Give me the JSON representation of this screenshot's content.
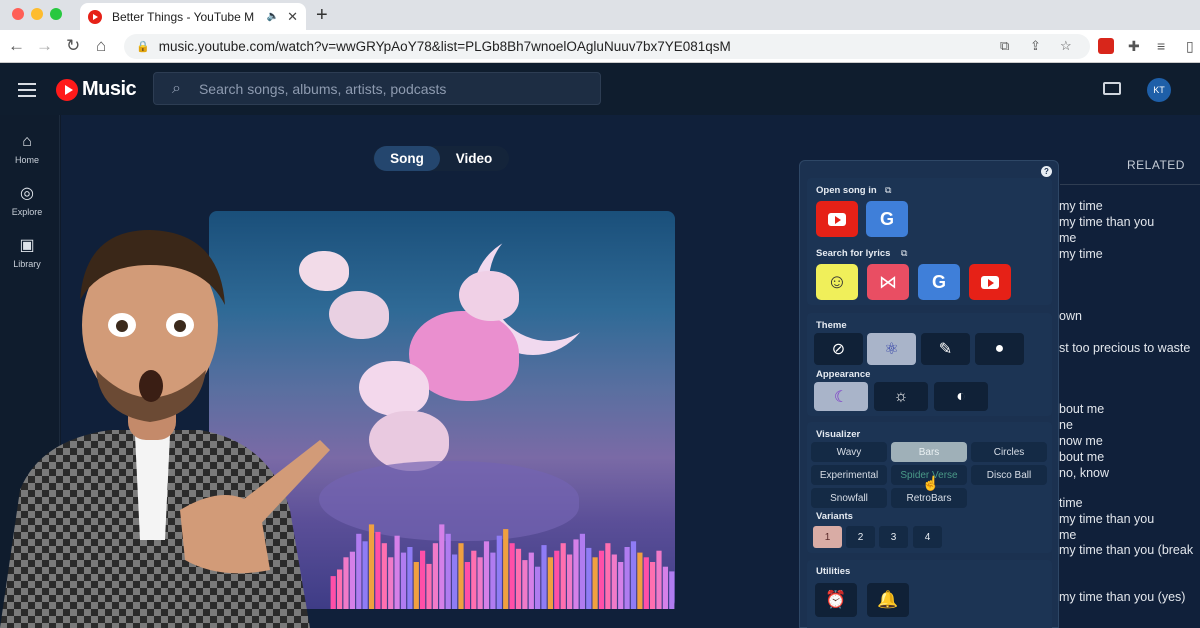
{
  "browser": {
    "tab_title": "Better Things - YouTube M",
    "audio_indicator": "🔈",
    "close_label": "✕",
    "new_tab_label": "+",
    "url": "music.youtube.com/watch?v=wwGRYpAoY78&list=PLGb8Bh7wnoelOAgluNuuv7bx7YE081qsM"
  },
  "header": {
    "logo_text": "Music",
    "search_placeholder": "Search songs, albums, artists, podcasts",
    "avatar_initials": "KT"
  },
  "sidebar": {
    "items": [
      {
        "label": "Home",
        "icon": "home-icon"
      },
      {
        "label": "Explore",
        "icon": "compass-icon"
      },
      {
        "label": "Library",
        "icon": "library-icon"
      }
    ]
  },
  "player": {
    "toggle": {
      "song_label": "Song",
      "video_label": "Video",
      "selected": "Song"
    },
    "visualizer_bar_levels": [
      0.35,
      0.42,
      0.55,
      0.61,
      0.8,
      0.72,
      0.9,
      0.82,
      0.7,
      0.55,
      0.78,
      0.6,
      0.66,
      0.5,
      0.62,
      0.48,
      0.7,
      0.9,
      0.8,
      0.58,
      0.7,
      0.5,
      0.62,
      0.55,
      0.72,
      0.6,
      0.78,
      0.85,
      0.7,
      0.64,
      0.52,
      0.6,
      0.45,
      0.68,
      0.55,
      0.62,
      0.7,
      0.58,
      0.74,
      0.8,
      0.65,
      0.55,
      0.62,
      0.7,
      0.58,
      0.5,
      0.66,
      0.72,
      0.6,
      0.55,
      0.5,
      0.62,
      0.45,
      0.4
    ]
  },
  "right_panel": {
    "related_tab": "RELATED",
    "lyrics": [
      "my time",
      "my time than you",
      "me",
      "my time",
      "own",
      "st too precious to waste",
      "bout me",
      "ne",
      "now me",
      "bout me",
      "no, know",
      "time",
      "my time than you",
      "me",
      "my time than you (break",
      "my time than you (yes)"
    ]
  },
  "extension_panel": {
    "help_icon": "?",
    "open_song_in": {
      "label": "Open song in",
      "buttons": [
        "youtube-icon",
        "google-icon"
      ]
    },
    "search_for_lyrics": {
      "label": "Search for lyrics",
      "buttons": [
        "genius-icon",
        "musixmatch-icon",
        "google-icon",
        "youtube-icon"
      ]
    },
    "theme": {
      "label": "Theme",
      "options": [
        "no-theme-icon",
        "atom-icon",
        "dropper-icon",
        "apple-icon"
      ],
      "selected_index": 1
    },
    "appearance": {
      "label": "Appearance",
      "options": [
        "moon-icon",
        "sun-icon",
        "auto-icon"
      ],
      "selected_index": 0
    },
    "visualizer": {
      "label": "Visualizer",
      "options": [
        "Wavy",
        "Bars",
        "Circles",
        "Experimental",
        "Spider Verse",
        "Disco Ball",
        "Snowfall",
        "RetroBars"
      ],
      "selected": "Bars"
    },
    "variants": {
      "label": "Variants",
      "options": [
        "1",
        "2",
        "3",
        "4"
      ],
      "selected": "1"
    },
    "utilities": {
      "label": "Utilities",
      "buttons": [
        "sleep-timer-icon",
        "bell-icon"
      ]
    }
  },
  "colors": {
    "yt_red": "#ff0000",
    "panel_bg": "#1b3150",
    "page_bg": "#10203a"
  }
}
